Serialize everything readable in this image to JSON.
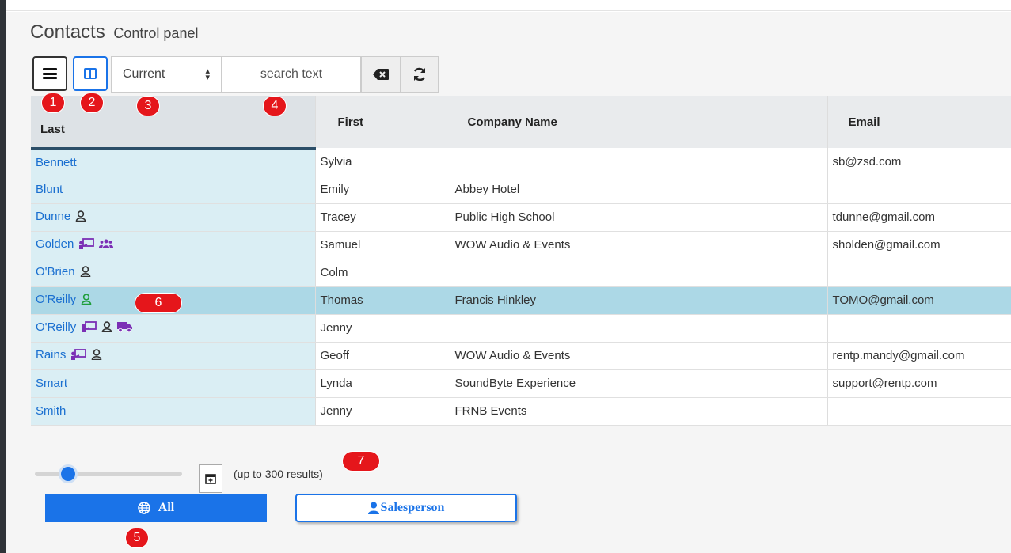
{
  "app": {
    "title": "Contacts",
    "subtitle": "Control panel"
  },
  "toolbar": {
    "filter_selected": "Current",
    "search_placeholder": "search text"
  },
  "table": {
    "columns": [
      "Last",
      "First",
      "Company Name",
      "Email"
    ],
    "rows": [
      {
        "last": "Bennett",
        "first": "Sylvia",
        "company": "",
        "email": "sb@zsd.com",
        "icons": []
      },
      {
        "last": "Blunt",
        "first": "Emily",
        "company": "Abbey Hotel",
        "email": "",
        "icons": []
      },
      {
        "last": "Dunne",
        "first": "Tracey",
        "company": "Public High School",
        "email": "tdunne@gmail.com",
        "icons": [
          "person-outline-icon"
        ]
      },
      {
        "last": "Golden",
        "first": "Samuel",
        "company": "WOW Audio & Events",
        "email": "sholden@gmail.com",
        "icons": [
          "presenter-icon",
          "group-icon"
        ]
      },
      {
        "last": "O'Brien",
        "first": "Colm",
        "company": "",
        "email": "",
        "icons": [
          "person-outline-icon"
        ]
      },
      {
        "last": "O'Reilly",
        "first": "Thomas",
        "company": "Francis Hinkley",
        "email": "TOMO@gmail.com",
        "icons": [
          "person-outline-green-icon"
        ],
        "selected": true
      },
      {
        "last": "O'Reilly",
        "first": "Jenny",
        "company": "",
        "email": "",
        "icons": [
          "presenter-icon",
          "person-outline-icon",
          "truck-icon"
        ]
      },
      {
        "last": "Rains",
        "first": "Geoff",
        "company": "WOW Audio & Events",
        "email": "rentp.mandy@gmail.com",
        "icons": [
          "presenter-icon",
          "person-outline-icon"
        ]
      },
      {
        "last": "Smart",
        "first": "Lynda",
        "company": "SoundByte Experience",
        "email": "support@rentp.com",
        "icons": []
      },
      {
        "last": "Smith",
        "first": "Jenny",
        "company": "FRNB Events",
        "email": "",
        "icons": []
      }
    ]
  },
  "footer": {
    "results_text": "(up to 300 results)",
    "seg_all_label": "All",
    "seg_salesperson_label": "Salesperson"
  },
  "callouts": [
    "1",
    "2",
    "3",
    "4",
    "5",
    "6",
    "7"
  ],
  "colors": {
    "accent": "#1a73e8",
    "callout": "#e5161b",
    "selected_row": "#acd8e6",
    "last_col": "#daeef4",
    "icon_purple": "#7b2fb5",
    "icon_green": "#1e9e3a"
  }
}
